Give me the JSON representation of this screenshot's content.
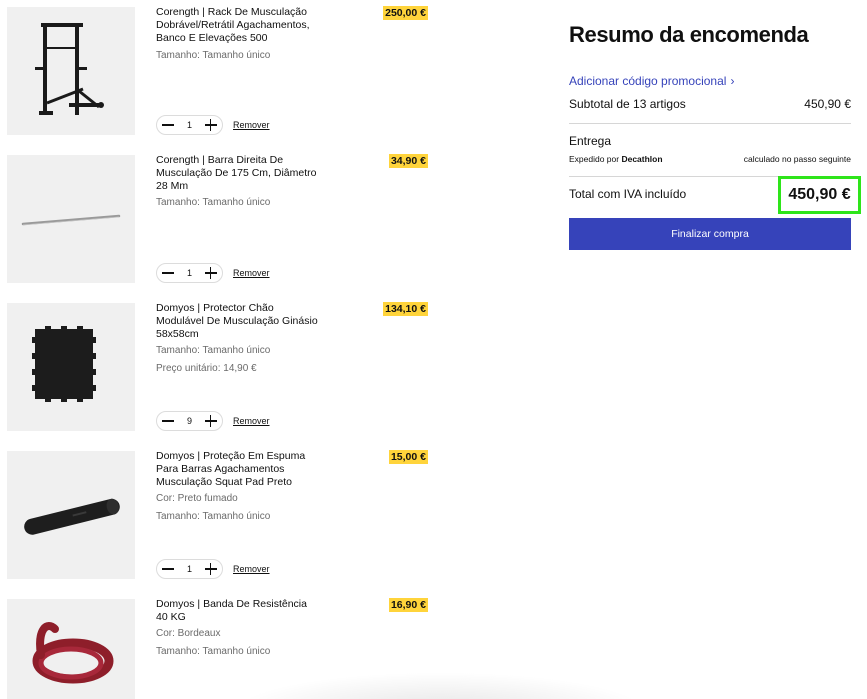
{
  "items": [
    {
      "name": "Corength | Rack De Musculação Dobrável/Retrátil Agachamentos, Banco E Elevações 500",
      "attributes": [
        "Tamanho: Tamanho único"
      ],
      "price": "250,00 €",
      "quantity": "1",
      "remove_label": "Remover",
      "image_icon": "squat-rack-image"
    },
    {
      "name": "Corength | Barra Direita De Musculação De 175 Cm, Diâmetro 28 Mm",
      "attributes": [
        "Tamanho: Tamanho único"
      ],
      "price": "34,90 €",
      "quantity": "1",
      "remove_label": "Remover",
      "image_icon": "barbell-image"
    },
    {
      "name": "Domyos | Protector Chão Modulável De Musculação Ginásio 58x58cm",
      "attributes": [
        "Tamanho: Tamanho único",
        "Preço unitário: 14,90 €"
      ],
      "price": "134,10 €",
      "quantity": "9",
      "remove_label": "Remover",
      "image_icon": "floor-mat-image"
    },
    {
      "name": "Domyos | Proteção Em Espuma Para Barras Agachamentos Musculação Squat Pad Preto",
      "attributes": [
        "Cor: Preto fumado",
        "Tamanho: Tamanho único"
      ],
      "price": "15,00 €",
      "quantity": "1",
      "remove_label": "Remover",
      "image_icon": "foam-pad-image"
    },
    {
      "name": "Domyos | Banda De Resistência 40 KG",
      "attributes": [
        "Cor: Bordeaux",
        "Tamanho: Tamanho único"
      ],
      "price": "16,90 €",
      "quantity": "",
      "remove_label": "",
      "image_icon": "resistance-band-image"
    }
  ],
  "summary": {
    "title": "Resumo da encomenda",
    "promo_label": "Adicionar código promocional",
    "subtotal_label": "Subtotal de 13 artigos",
    "subtotal_value": "450,90 €",
    "shipping_title": "Entrega",
    "shipped_by_prefix": "Expedido por",
    "shipped_by_name": "Decathlon",
    "shipping_calc": "calculado no passo seguinte",
    "total_label": "Total com IVA incluído",
    "total_value": "450,90 €",
    "checkout_label": "Finalizar compra"
  },
  "colors": {
    "accent": "#3643ba",
    "price_highlight": "#ffd43b",
    "total_highlight_border": "#2ee51a"
  }
}
